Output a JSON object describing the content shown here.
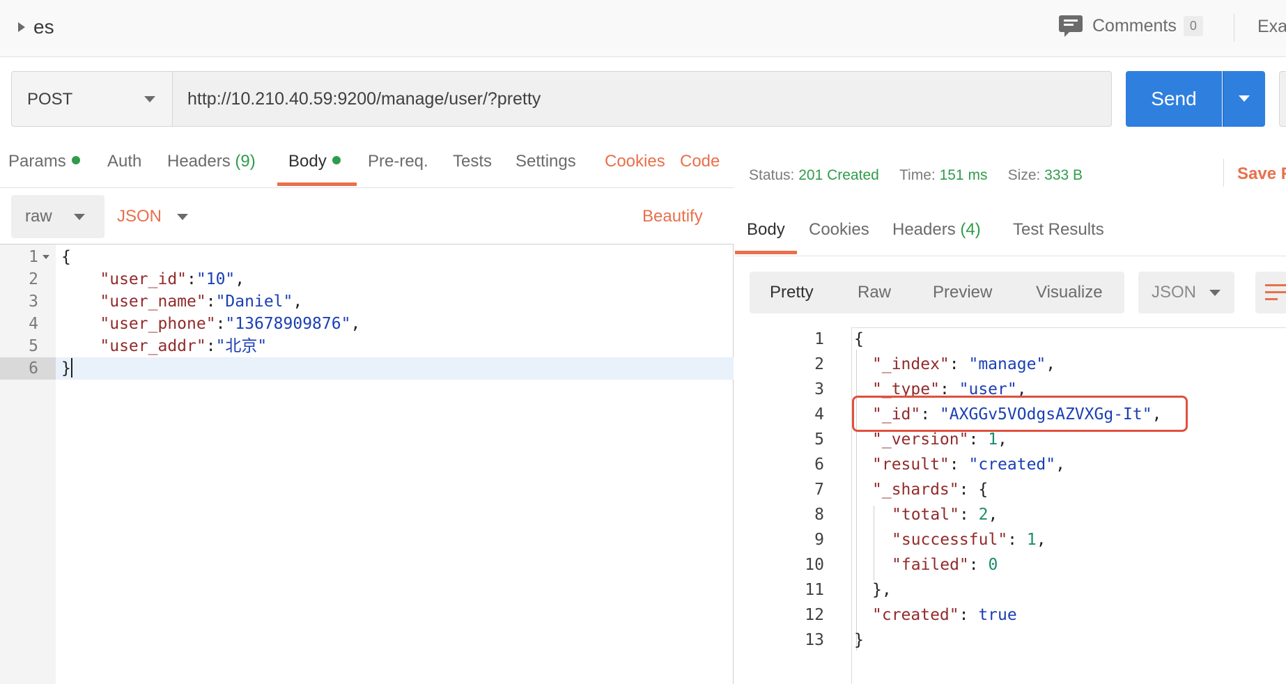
{
  "header": {
    "collection_name": "es",
    "comments_label": "Comments",
    "comments_count": "0",
    "examples_label": "Exa"
  },
  "request": {
    "method": "POST",
    "url": "http://10.210.40.59:9200/manage/user/?pretty",
    "send_label": "Send"
  },
  "request_tabs": {
    "params": "Params",
    "auth": "Auth",
    "headers": "Headers",
    "headers_count": "(9)",
    "body": "Body",
    "prereq": "Pre-req.",
    "tests": "Tests",
    "settings": "Settings",
    "cookies": "Cookies",
    "code": "Code"
  },
  "body_mode": {
    "mode": "raw",
    "format": "JSON",
    "beautify": "Beautify"
  },
  "request_body": {
    "lines": [
      {
        "num": "1",
        "open": "{"
      },
      {
        "num": "2",
        "key": "\"user_id\"",
        "value": "\"10\""
      },
      {
        "num": "3",
        "key": "\"user_name\"",
        "value": "\"Daniel\""
      },
      {
        "num": "4",
        "key": "\"user_phone\"",
        "value": "\"13678909876\""
      },
      {
        "num": "5",
        "key": "\"user_addr\"",
        "value": "\"北京\""
      },
      {
        "num": "6",
        "close": "}"
      }
    ]
  },
  "response": {
    "status_label": "Status:",
    "status_value": "201 Created",
    "time_label": "Time:",
    "time_value": "151 ms",
    "size_label": "Size:",
    "size_value": "333 B",
    "save_label": "Save R",
    "tabs": {
      "body": "Body",
      "cookies": "Cookies",
      "headers": "Headers",
      "headers_count": "(4)",
      "test_results": "Test Results"
    },
    "views": {
      "pretty": "Pretty",
      "raw": "Raw",
      "preview": "Preview",
      "visualize": "Visualize"
    },
    "format": "JSON",
    "lines": [
      {
        "num": "1",
        "text": "{"
      },
      {
        "num": "2",
        "key": "\"_index\"",
        "value": "\"manage\"",
        "trail": ","
      },
      {
        "num": "3",
        "key": "\"_type\"",
        "value": "\"user\"",
        "trail": ","
      },
      {
        "num": "4",
        "key": "\"_id\"",
        "value": "\"AXGGv5VOdgsAZVXGg-It\"",
        "trail": ","
      },
      {
        "num": "5",
        "key": "\"_version\"",
        "value": "1",
        "trail": ","
      },
      {
        "num": "6",
        "key": "\"result\"",
        "value": "\"created\"",
        "trail": ","
      },
      {
        "num": "7",
        "key": "\"_shards\"",
        "value": "{",
        "trail": ""
      },
      {
        "num": "8",
        "key": "\"total\"",
        "value": "2",
        "trail": ","
      },
      {
        "num": "9",
        "key": "\"successful\"",
        "value": "1",
        "trail": ","
      },
      {
        "num": "10",
        "key": "\"failed\"",
        "value": "0",
        "trail": ""
      },
      {
        "num": "11",
        "text": "},"
      },
      {
        "num": "12",
        "key": "\"created\"",
        "value": "true",
        "trail": ""
      },
      {
        "num": "13",
        "text": "}"
      }
    ]
  },
  "colors": {
    "accent_orange": "#e8704b",
    "send_blue": "#2f7fdf",
    "status_green": "#2f9c4a",
    "highlight_red": "#e0503e"
  },
  "icons": {
    "collection_caret": "caret-right-icon",
    "comments": "comment-icon",
    "wrap": "wrap-lines-icon"
  }
}
